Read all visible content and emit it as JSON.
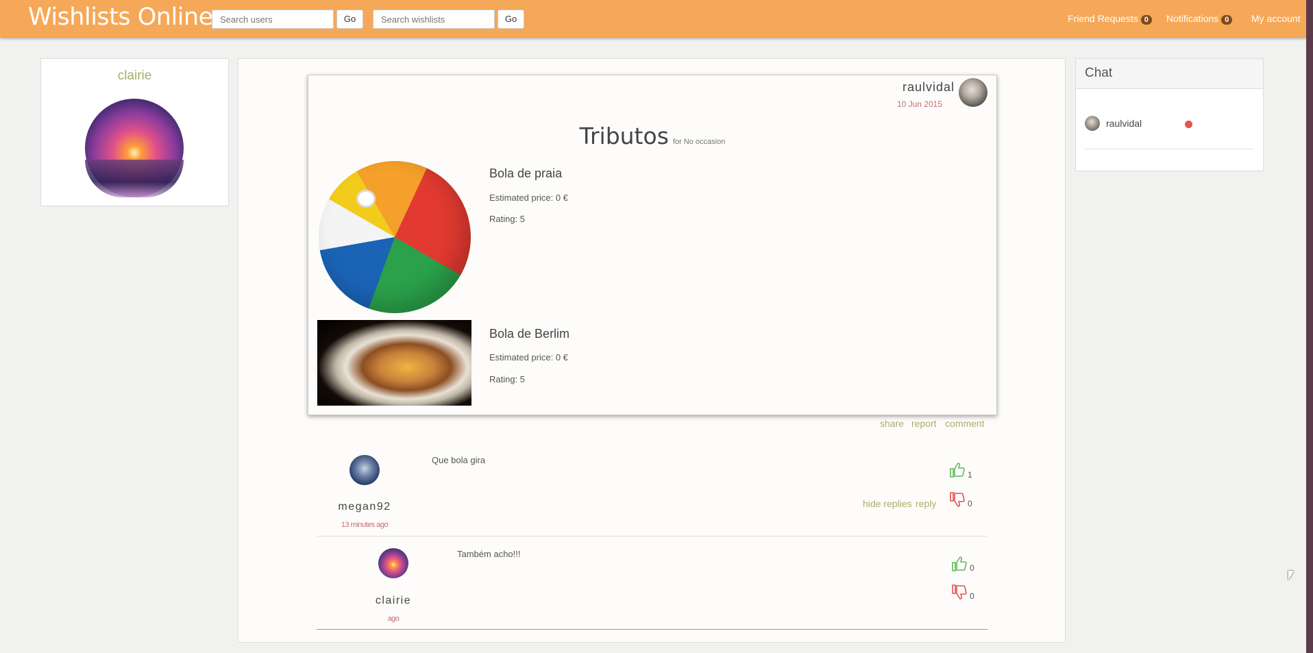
{
  "navbar": {
    "brand": "Wishlists Online",
    "search_users_placeholder": "Search users",
    "search_wishlists_placeholder": "Search wishlists",
    "go_label": "Go",
    "friend_requests_label": "Friend Requests",
    "friend_requests_count": "0",
    "notifications_label": "Notifications",
    "notifications_count": "0",
    "my_account_label": "My account",
    "bg_color": "#f5a857"
  },
  "profile": {
    "username": "clairie"
  },
  "wishlist": {
    "owner": "raulvidal",
    "date": "10 Jun 2015",
    "title": "Tributos",
    "occasion": "for No occasion",
    "items": [
      {
        "name": "Bola de praia",
        "price": "Estimated price: 0 €",
        "rating": "Rating: 5",
        "image": "beach-ball-image"
      },
      {
        "name": "Bola de Berlim",
        "price": "Estimated price: 0 €",
        "rating": "Rating: 5",
        "image": "berliner-pastry-image"
      }
    ],
    "actions": {
      "share": "share",
      "report": "report",
      "comment": "comment"
    }
  },
  "comments": [
    {
      "author": "megan92",
      "time": "13 minutes ago",
      "text": "Que bola gira",
      "likes": "1",
      "dislikes": "0",
      "hide_replies": "hide replies",
      "reply": "reply"
    },
    {
      "author": "clairie",
      "time": "ago",
      "text": "Também acho!!!",
      "likes": "0",
      "dislikes": "0"
    }
  ],
  "chat": {
    "title": "Chat",
    "users": [
      {
        "name": "raulvidal",
        "status": "offline",
        "status_color": "#e8524f"
      }
    ]
  },
  "colors": {
    "accent_link": "#a8ad6a",
    "date_color": "#c0706f",
    "like_color": "#5fb85b",
    "dislike_color": "#e0504d"
  }
}
